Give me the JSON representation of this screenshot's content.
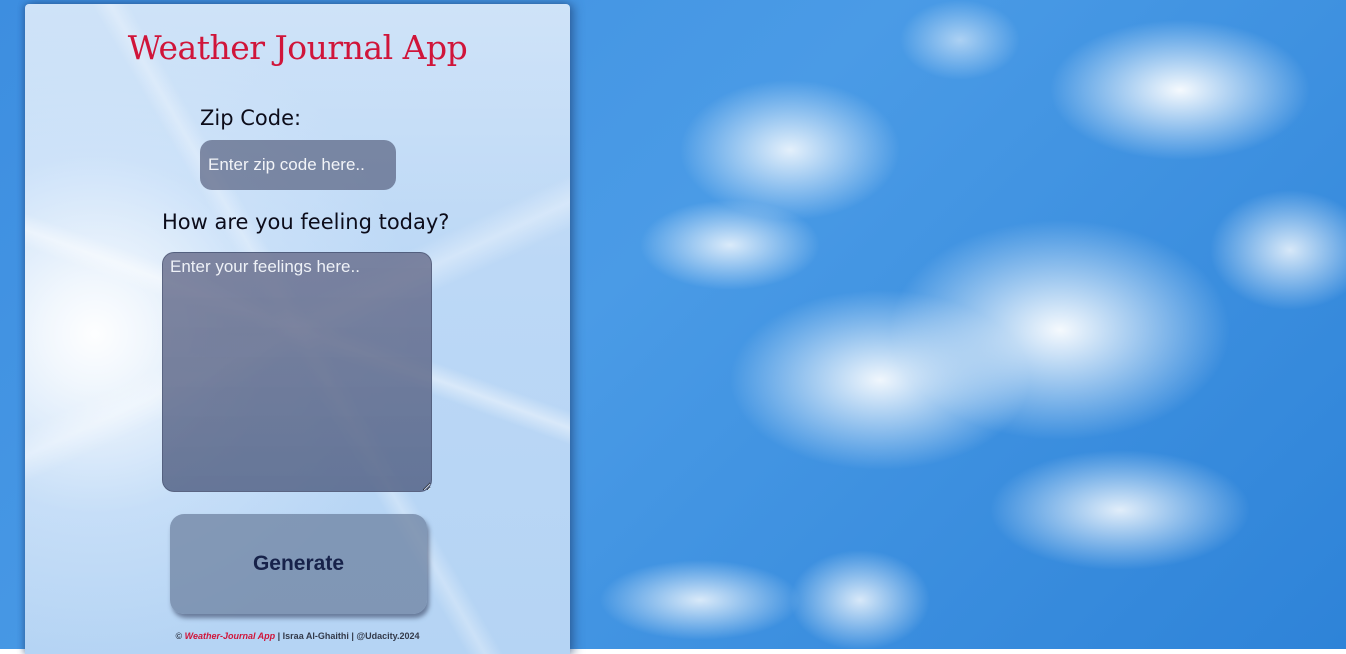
{
  "app": {
    "title": "Weather Journal App"
  },
  "form": {
    "zip_label": "Zip Code:",
    "zip_placeholder": "Enter zip code here..",
    "zip_value": "",
    "feelings_label": "How are you feeling today?",
    "feelings_placeholder": "Enter your feelings here..",
    "feelings_value": "",
    "generate_label": "Generate"
  },
  "footer": {
    "copyright": "©",
    "app_name": "Weather-Journal App",
    "author": "| Israa Al-Ghaithi | @Udacity.2024"
  },
  "colors": {
    "title": "#d0153a",
    "button_text": "#17224a",
    "sky": "#3d8ee0"
  }
}
